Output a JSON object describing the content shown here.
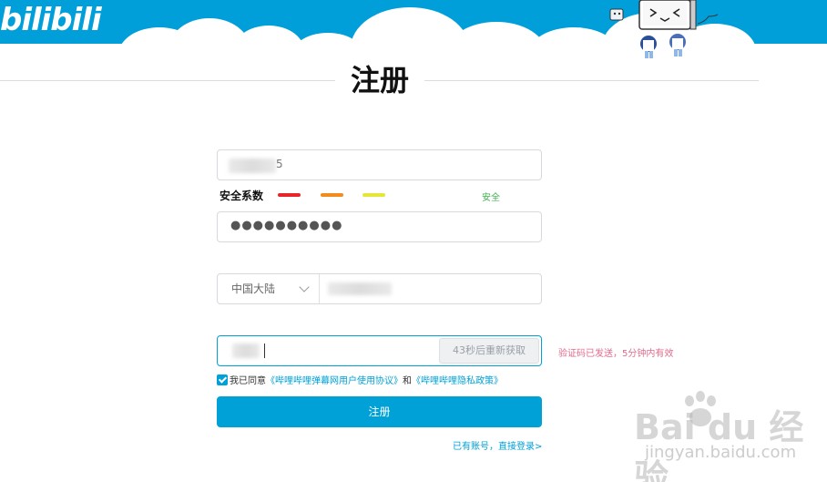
{
  "header": {
    "logo_text": "bilibili"
  },
  "page": {
    "title": "注册"
  },
  "form": {
    "username_suffix": "5",
    "strength": {
      "label": "安全系数",
      "level_text": "安全",
      "colors": [
        "#e8262a",
        "#f48b1f",
        "#e6e63a"
      ]
    },
    "password_mask": "●●●●●●●●●●",
    "phone": {
      "region": "中国大陆"
    },
    "code": {
      "resend_label": "43秒后重新获取",
      "tip": "验证码已发送，5分钟内有效"
    },
    "agreement": {
      "prefix": "我已同意",
      "link1": "《哔哩哔哩弹幕网用户使用协议》",
      "and": "和",
      "link2": "《哔哩哔哩隐私政策》"
    },
    "submit_label": "注册",
    "login_link": "已有账号，直接登录>"
  },
  "watermark": {
    "logo": "Bai du 经验",
    "sub": "jingyan.baidu.com"
  },
  "colors": {
    "brand": "#00a1d6",
    "banner": "#009fd9"
  }
}
